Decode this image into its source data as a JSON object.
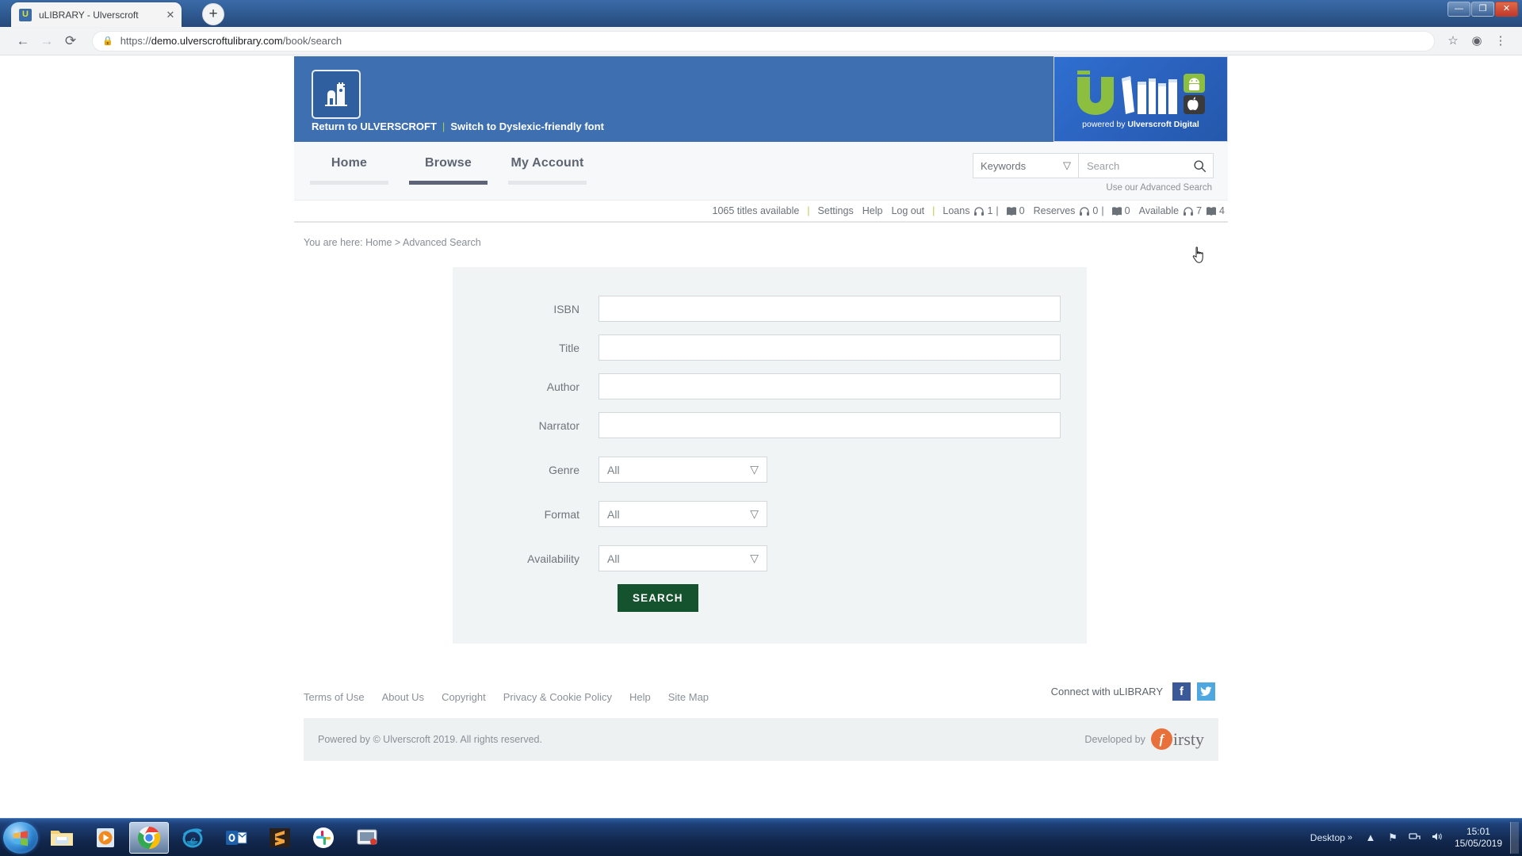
{
  "browser": {
    "tab_title": "uLIBRARY - Ulverscroft",
    "tab_favicon": "U",
    "tab_close": "✕",
    "newtab_label": "+",
    "url_protocol": "https://",
    "url_domain": "demo.ulverscroftulibrary.com",
    "url_path": "/book/search",
    "lock_icon": "🔒",
    "back_icon": "←",
    "forward_icon": "→",
    "reload_icon": "⟳",
    "star_icon": "☆",
    "profile_icon": "◉",
    "menu_icon": "⋮",
    "minimize": "—",
    "maximize": "❐",
    "close": "✕"
  },
  "banner": {
    "return_link": "Return to ULVERSCROFT",
    "separator": "|",
    "dyslexic_link": "Switch to Dyslexic-friendly font",
    "logo_tagline_prefix": "powered by ",
    "logo_tagline_brand": "Ulverscroft Digital"
  },
  "nav": {
    "items": [
      {
        "label": "Home",
        "active": false
      },
      {
        "label": "Browse",
        "active": true
      },
      {
        "label": "My Account",
        "active": false
      }
    ]
  },
  "search": {
    "scope_value": "Keywords",
    "scope_caret": "▽",
    "input_placeholder": "Search",
    "input_value": "",
    "advanced_link": "Use our Advanced Search"
  },
  "status": {
    "titles_available": "1065 titles available",
    "settings": "Settings",
    "help": "Help",
    "logout": "Log out",
    "loans_label": "Loans",
    "loans_audio": "1",
    "loans_ebook": "0",
    "reserves_label": "Reserves",
    "reserves_audio": "0",
    "reserves_ebook": "0",
    "available_label": "Available",
    "available_audio": "7",
    "available_ebook": "4",
    "pipe": "|"
  },
  "breadcrumb": {
    "prefix": "You are here:",
    "home": "Home",
    "chevron": ">",
    "current": "Advanced Search"
  },
  "form": {
    "fields": [
      {
        "label": "ISBN",
        "type": "text",
        "value": "",
        "placeholder": ""
      },
      {
        "label": "Title",
        "type": "text",
        "value": "",
        "placeholder": ""
      },
      {
        "label": "Author",
        "type": "text",
        "value": "",
        "placeholder": ""
      },
      {
        "label": "Narrator",
        "type": "text",
        "value": "",
        "placeholder": ""
      },
      {
        "label": "Genre",
        "type": "select",
        "value": "All"
      },
      {
        "label": "Format",
        "type": "select",
        "value": "All"
      },
      {
        "label": "Availability",
        "type": "select",
        "value": "All"
      }
    ],
    "select_caret": "▽",
    "submit_label": "SEARCH"
  },
  "footer": {
    "links": [
      "Terms of Use",
      "About Us",
      "Copyright",
      "Privacy & Cookie Policy",
      "Help",
      "Site Map"
    ],
    "connect_label": "Connect with uLIBRARY",
    "facebook_glyph": "f",
    "twitter_glyph": "▼",
    "copyright": "Powered by © Ulverscroft 2019. All rights reserved.",
    "developed_label": "Developed by",
    "firsty_mark": "f",
    "firsty_rest": "irsty"
  },
  "taskbar": {
    "items": [
      {
        "name": "start-orb",
        "active": false
      },
      {
        "name": "file-explorer",
        "active": false
      },
      {
        "name": "media-player",
        "active": false
      },
      {
        "name": "google-chrome",
        "active": true
      },
      {
        "name": "internet-explorer",
        "active": false
      },
      {
        "name": "outlook",
        "active": false
      },
      {
        "name": "sublime-text",
        "active": false
      },
      {
        "name": "slack",
        "active": false
      },
      {
        "name": "screen-recorder",
        "active": false
      }
    ],
    "desktop_label": "Desktop",
    "overflow_chevron": "»",
    "tray_up": "▲",
    "flag_icon": "⚑",
    "network_icon": "🖧",
    "volume_icon": "🔊",
    "time": "15:01",
    "date": "15/05/2019"
  },
  "colors": {
    "banner_blue": "#3e6fb0",
    "logo_green": "#8cbf3f",
    "accent_green": "#14532d",
    "nav_active": "#5d6477",
    "card_bg": "#f1f4f5",
    "firsty_orange": "#e8703a"
  }
}
